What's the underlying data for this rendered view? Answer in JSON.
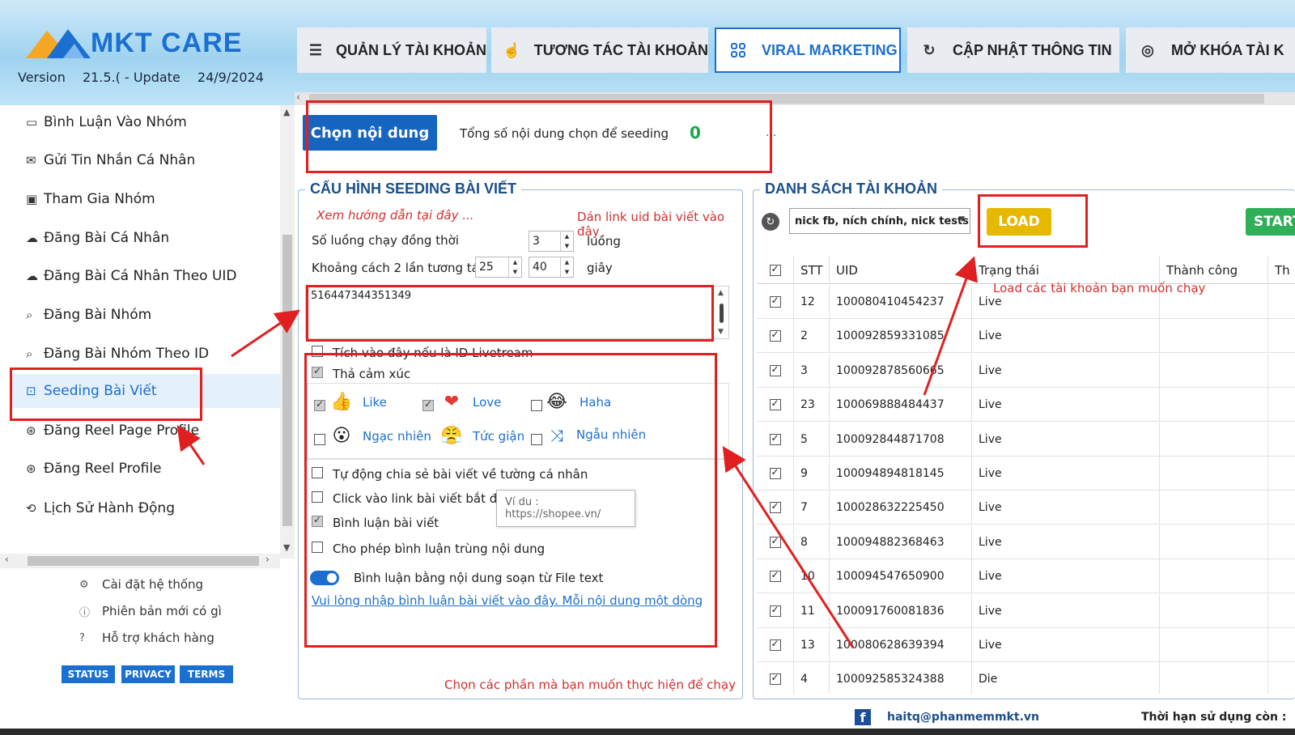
{
  "header": {
    "logo_text": "MKT CARE",
    "version_label": "Version",
    "version_value": "21.5.(",
    "update_label": "- Update",
    "update_date": "24/9/2024",
    "tabs": [
      {
        "label": "QUẢN LÝ TÀI KHOẢN",
        "icon": "list-icon"
      },
      {
        "label": "TƯƠNG TÁC TÀI KHOẢN",
        "icon": "hand-pointer-icon"
      },
      {
        "label": "VIRAL MARKETING",
        "icon": "grid-icon"
      },
      {
        "label": "CẬP NHẬT THÔNG TIN",
        "icon": "refresh-check-icon"
      },
      {
        "label": "MỞ KHÓA TÀI K",
        "icon": "fingerprint-icon"
      }
    ],
    "active_tab": "VIRAL MARKETING"
  },
  "sidebar": {
    "items": [
      {
        "label": "Bình Luận Vào Nhóm",
        "icon": "comment-icon"
      },
      {
        "label": "Gửi Tin Nhắn Cá Nhân",
        "icon": "message-icon"
      },
      {
        "label": "Tham Gia Nhóm",
        "icon": "group-icon"
      },
      {
        "label": "Đăng Bài Cá Nhân",
        "icon": "upload-cloud-icon"
      },
      {
        "label": "Đăng Bài Cá Nhân Theo UID",
        "icon": "upload-cloud-icon"
      },
      {
        "label": "Đăng Bài Nhóm",
        "icon": "group-search-icon"
      },
      {
        "label": "Đăng Bài Nhóm Theo ID",
        "icon": "group-search-icon"
      },
      {
        "label": "Seeding Bài Viết",
        "icon": "seeding-icon"
      },
      {
        "label": "Đăng Reel Page Profile",
        "icon": "reel-icon"
      },
      {
        "label": "Đăng Reel Profile",
        "icon": "reel-icon"
      },
      {
        "label": "Lịch Sử Hành Động",
        "icon": "history-icon"
      }
    ],
    "active_item": "Seeding Bài Viết",
    "footer": [
      {
        "label": "Cài đặt hệ thống",
        "icon": "gear-icon"
      },
      {
        "label": "Phiên bản mới có gì",
        "icon": "info-icon"
      },
      {
        "label": "Hỗ trợ khách hàng",
        "icon": "help-icon"
      }
    ],
    "badges": [
      "STATUS",
      "PRIVACY",
      "TERMS"
    ]
  },
  "top_strip": {
    "choose_button": "Chọn nội dung",
    "total_label": "Tổng số nội dung chọn để seeding",
    "total_count": "0",
    "dots": "..."
  },
  "config": {
    "title": "CẤU HÌNH SEEDING BÀI VIẾT",
    "guide_link": "Xem hướng dẫn tại đây ...",
    "paste_note": "Dán link uid bài viết vào đây",
    "threads_label": "Số luồng chạy đồng thời",
    "threads_value": "3",
    "threads_unit": "luồng",
    "interval_label": "Khoảng cách 2 lần tương tác",
    "interval_from": "25",
    "interval_to": "40",
    "interval_unit": "giây",
    "uid_text": "516447344351349",
    "livestream_label": "Tích vào đây nếu là ID Livetream",
    "react_label": "Thả cảm xúc",
    "reactions": [
      {
        "label": "Like",
        "checked": true,
        "icon": "like-icon"
      },
      {
        "label": "Love",
        "checked": true,
        "icon": "love-icon"
      },
      {
        "label": "Haha",
        "checked": false,
        "icon": "haha-icon"
      },
      {
        "label": "Ngạc nhiên",
        "checked": false,
        "icon": "wow-icon"
      },
      {
        "label": "Tức giận",
        "checked": false,
        "icon": "angry-icon"
      },
      {
        "label": "Ngẫu nhiên",
        "checked": false,
        "icon": "shuffle-icon"
      }
    ],
    "share_label": "Tự động chia sẻ bài viết về tường cá nhân",
    "click_label": "Click vào link bài viết bắt đầu",
    "click_placeholder": "Ví du : https://shopee.vn/",
    "comment_label": "Bình luận bài viết",
    "dup_label": "Cho phép bình luận trùng nội dung",
    "file_label": "Bình luận bằng nội dung soạn từ File text",
    "comment_link": "Vui lòng nhập bình luận bài viết vào đây. Mỗi nội dung một dòng",
    "bottom_note": "Chọn các phần mà bạn muốn thực hiện để chạy"
  },
  "accounts": {
    "title": "DANH SÁCH TÀI KHOẢN",
    "select_value": "nick fb, ních chính, nick tests",
    "load_button": "LOAD",
    "start_button": "START",
    "load_note": "Load các tài khoản bạn muốn chạy",
    "columns": [
      "STT",
      "UID",
      "Trạng thái",
      "Thành công",
      "Th"
    ],
    "rows": [
      {
        "stt": "12",
        "uid": "100080410454237",
        "status": "Live"
      },
      {
        "stt": "2",
        "uid": "100092859331085",
        "status": "Live"
      },
      {
        "stt": "3",
        "uid": "100092878560665",
        "status": "Live"
      },
      {
        "stt": "23",
        "uid": "100069888484437",
        "status": "Live"
      },
      {
        "stt": "5",
        "uid": "100092844871708",
        "status": "Live"
      },
      {
        "stt": "9",
        "uid": "100094894818145",
        "status": "Live"
      },
      {
        "stt": "7",
        "uid": "100028632225450",
        "status": "Live"
      },
      {
        "stt": "8",
        "uid": "100094882368463",
        "status": "Live"
      },
      {
        "stt": "10",
        "uid": "100094547650900",
        "status": "Live"
      },
      {
        "stt": "11",
        "uid": "100091760081836",
        "status": "Live"
      },
      {
        "stt": "13",
        "uid": "100080628639394",
        "status": "Live"
      },
      {
        "stt": "4",
        "uid": "100092585324388",
        "status": "Die"
      }
    ]
  },
  "footer": {
    "email": "haitq@phanmemmkt.vn",
    "term_label": "Thời hạn sử dụng còn :"
  },
  "colors": {
    "accent": "#1b6fd0",
    "load": "#e6b800",
    "start": "#2eaf58",
    "annotation": "#e02020"
  }
}
